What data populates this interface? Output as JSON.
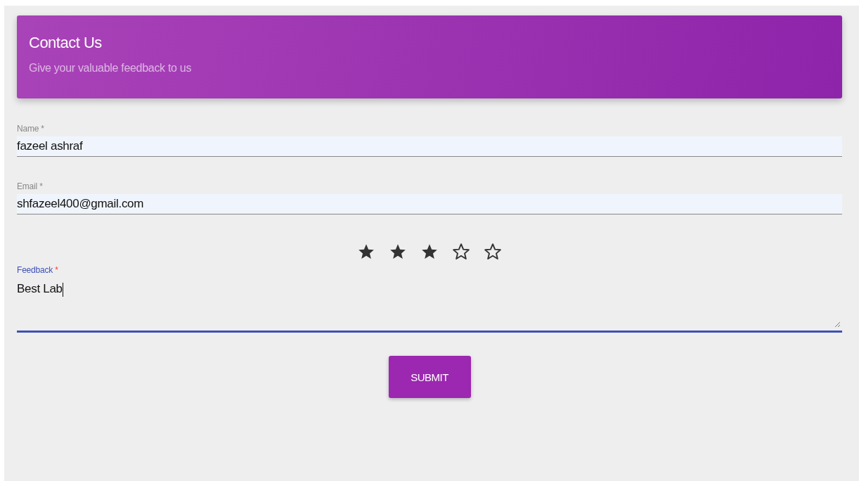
{
  "header": {
    "title": "Contact Us",
    "subtitle": "Give your valuable feedback to us"
  },
  "fields": [
    {
      "kind": "input",
      "label": "Name",
      "mark": "*",
      "value": "fazeel ashraf",
      "focused": false
    },
    {
      "kind": "input",
      "label": "Email",
      "mark": "*",
      "value": "shfazeel400@gmail.com",
      "focused": false
    }
  ],
  "rating": {
    "stars": 3
  },
  "feedback": {
    "kind": "textarea",
    "label": "Feedback",
    "mark": "*",
    "value": "Best Lab",
    "focused": true
  },
  "submit": {
    "label": "SUBMIT"
  }
}
